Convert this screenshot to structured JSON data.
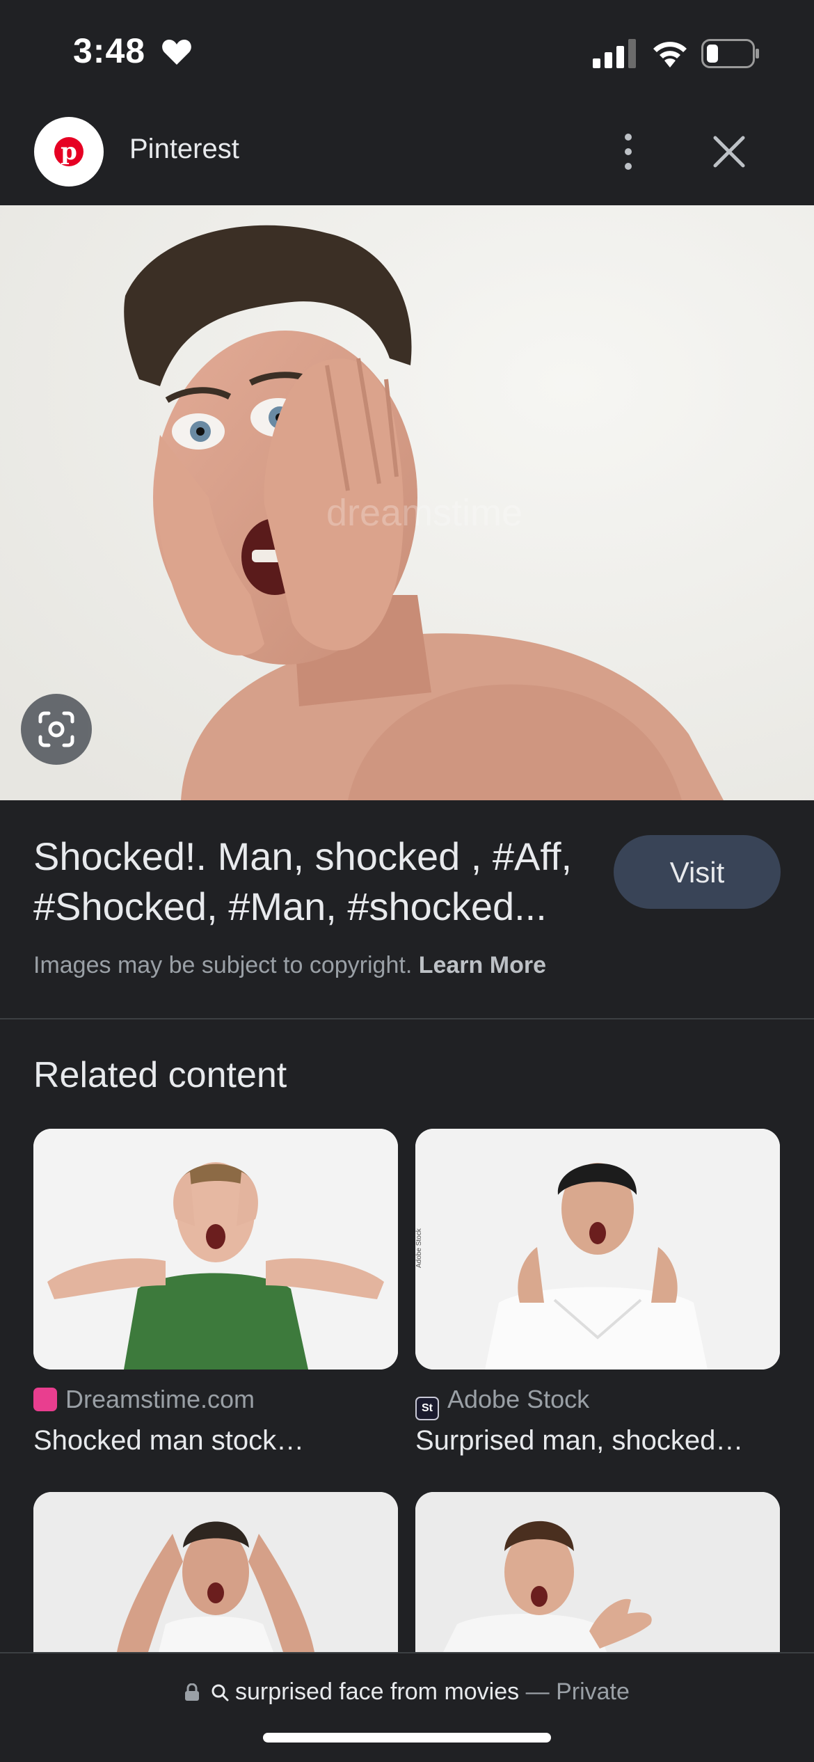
{
  "status_bar": {
    "time": "3:48",
    "icons": [
      "heart-icon",
      "cellular-signal-icon",
      "wifi-icon",
      "battery-icon"
    ]
  },
  "header": {
    "site_name": "Pinterest",
    "logo_icon": "pinterest-logo",
    "logo_letter": "p",
    "menu_icon": "more-vert-icon",
    "close_icon": "close-icon"
  },
  "main_image": {
    "watermark": "dreamstime",
    "lens_icon": "google-lens-icon"
  },
  "result": {
    "title": "Shocked!. Man, shocked , #Aff, #Shocked, #Man, #shocked...",
    "visit_label": "Visit",
    "copyright_text": "Images may be subject to copyright.",
    "learn_more_label": "Learn More"
  },
  "related": {
    "heading": "Related content",
    "items": [
      {
        "source": "Dreamstime.com",
        "caption": "Shocked man stock…",
        "source_icon": "dreamstime-icon"
      },
      {
        "source": "Adobe Stock",
        "caption": "Surprised man, shocked…",
        "source_icon": "adobe-stock-icon",
        "source_icon_text": "St"
      },
      {
        "source": "",
        "caption": ""
      },
      {
        "source": "",
        "caption": ""
      }
    ]
  },
  "bottom_bar": {
    "url": "surprised face from movies",
    "separator": "—",
    "mode": "Private",
    "lock_icon": "lock-icon",
    "search_icon": "search-icon"
  },
  "colors": {
    "background": "#202124",
    "visit_button": "#394457",
    "pinterest_red": "#e60023",
    "dreamstime_pink": "#e93e8f",
    "adobe_dark": "#1a1a2e"
  }
}
